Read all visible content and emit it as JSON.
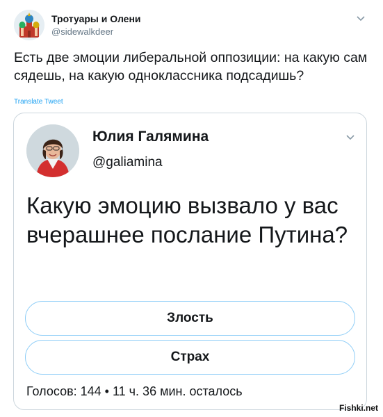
{
  "outer_tweet": {
    "name": "Тротуары и Олени",
    "handle": "@sidewalkdeer",
    "text": "Есть две эмоции либеральной оппозиции: на какую сам сядешь, на какую одноклассника подсадишь?",
    "translate_label": "Translate Tweet",
    "avatar_icon": "moscow-cathedral-icon",
    "menu_icon": "chevron-down-icon"
  },
  "quoted_tweet": {
    "name": "Юлия Галямина",
    "handle": "@galiamina",
    "question": "Какую эмоцию вызвало у вас вчерашнее послание Путина?",
    "avatar_icon": "profile-photo-icon",
    "menu_icon": "chevron-down-icon",
    "poll": {
      "options": [
        "Злость",
        "Страх"
      ],
      "footer": "Голосов: 144 • 11 ч. 36 мин. осталось"
    }
  },
  "watermark": "Fishki.net",
  "colors": {
    "link": "#1da1f2",
    "secondary_text": "#657786",
    "poll_border": "#8ecdf7",
    "card_border": "#ccd6dd"
  }
}
